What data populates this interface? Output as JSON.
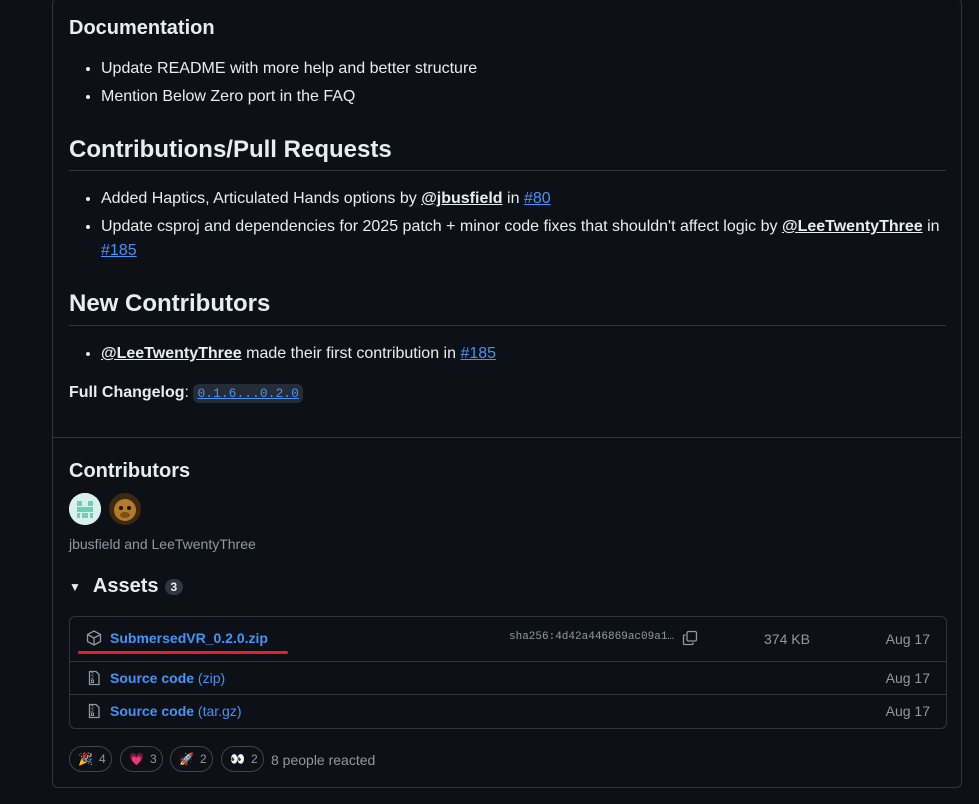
{
  "documentation": {
    "heading": "Documentation",
    "items": [
      "Update README with more help and better structure",
      "Mention Below Zero port in the FAQ"
    ]
  },
  "contributions": {
    "heading": "Contributions/Pull Requests",
    "item1": {
      "text": "Added Haptics, Articulated Hands options by ",
      "user": "@jbusfield",
      "mid": " in ",
      "pr": "#80"
    },
    "item2": {
      "text": "Update csproj and dependencies for 2025 patch + minor code fixes that shouldn't affect logic by ",
      "user": "@LeeTwentyThree",
      "mid": " in",
      "pr": "#185"
    }
  },
  "new_contributors": {
    "heading": "New Contributors",
    "item": {
      "user": "@LeeTwentyThree",
      "text": " made their first contribution in ",
      "pr": "#185"
    }
  },
  "changelog": {
    "label": "Full Changelog",
    "colon": ":",
    "range": "0.1.6...0.2.0"
  },
  "contributors": {
    "heading": "Contributors",
    "names": "jbusfield and LeeTwentyThree"
  },
  "assets": {
    "heading": "Assets",
    "count": "3",
    "rows": [
      {
        "name": "SubmersedVR_0.2.0.zip",
        "sha": "sha256:4d42a446869ac09a1…",
        "size": "374 KB",
        "date": "Aug 17",
        "icon": "package-icon"
      },
      {
        "name": "Source code",
        "suffix": "(zip)",
        "date": "Aug 17",
        "icon": "file-zip-icon"
      },
      {
        "name": "Source code",
        "suffix": "(tar.gz)",
        "date": "Aug 17",
        "icon": "file-zip-icon"
      }
    ]
  },
  "reactions": {
    "items": [
      {
        "emoji": "🎉",
        "count": "4",
        "name": "tada"
      },
      {
        "emoji": "💗",
        "count": "3",
        "name": "heart"
      },
      {
        "emoji": "🚀",
        "count": "2",
        "name": "rocket"
      },
      {
        "emoji": "👀",
        "count": "2",
        "name": "eyes"
      }
    ],
    "summary": "8 people reacted"
  },
  "colors": {
    "accent": "#4493f8",
    "annotation": "#e5202a",
    "background": "#0d1117"
  }
}
